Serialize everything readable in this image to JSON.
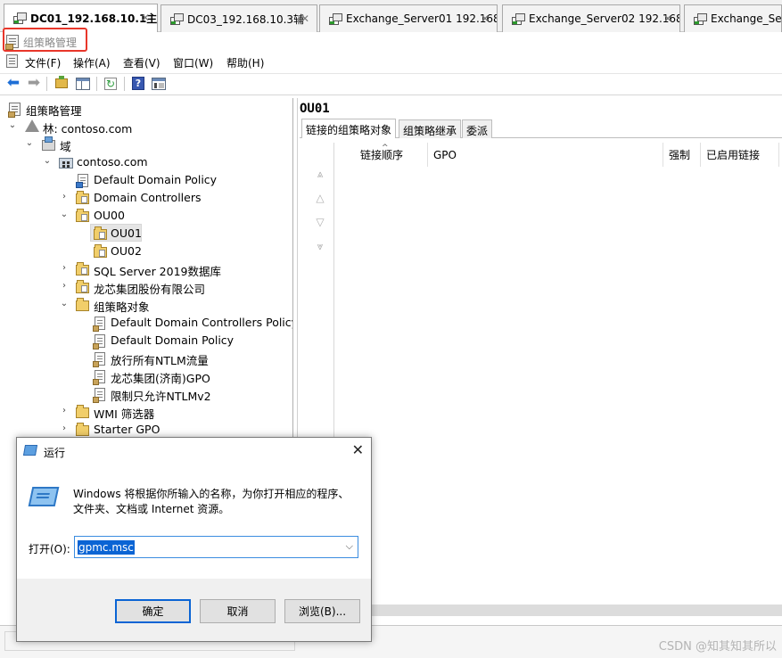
{
  "vm_tabs": [
    {
      "title": "DC01_192.168.10.1主",
      "active": true
    },
    {
      "title": "DC03_192.168.10.3辅",
      "active": false
    },
    {
      "title": "Exchange_Server01 192.168....",
      "active": false
    },
    {
      "title": "Exchange_Server02 192.168....",
      "active": false
    },
    {
      "title": "Exchange_Server",
      "active": false
    }
  ],
  "app": {
    "title": "组策略管理"
  },
  "menu": [
    "文件(F)",
    "操作(A)",
    "查看(V)",
    "窗口(W)",
    "帮助(H)"
  ],
  "tree": {
    "root": "组策略管理",
    "forest": "林: contoso.com",
    "domains": "域",
    "domain": "contoso.com",
    "default_domain_policy": "Default Domain Policy",
    "domain_controllers": "Domain Controllers",
    "ou00": "OU00",
    "ou01": "OU01",
    "ou02": "OU02",
    "sql_ou": "SQL Server 2019数据库",
    "loongson_ou": "龙芯集团股份有限公司",
    "gpo_container": "组策略对象",
    "gpos": [
      "Default Domain Controllers Policy",
      "Default Domain Policy",
      "放行所有NTLM流量",
      "龙芯集团(济南)GPO",
      "限制只允许NTLMv2"
    ],
    "wmi_filters": "WMI 筛选器",
    "starter_gpo": "Starter GPO"
  },
  "detail": {
    "title": "OU01",
    "tabs": [
      "链接的组策略对象",
      "组策略继承",
      "委派"
    ],
    "columns": [
      "链接顺序",
      "GPO",
      "强制",
      "已启用链接"
    ]
  },
  "run_dialog": {
    "title": "运行",
    "description_line1": "Windows 将根据你所输入的名称，为你打开相应的程序、",
    "description_line2": "文件夹、文档或 Internet 资源。",
    "open_label": "打开(O):",
    "input_value": "gpmc.msc",
    "ok": "确定",
    "cancel": "取消",
    "browse": "浏览(B)..."
  },
  "watermark": "CSDN @知其知其所以",
  "colors": {
    "highlight_border": "#e8362a",
    "selection_blue": "#0a64d4"
  }
}
